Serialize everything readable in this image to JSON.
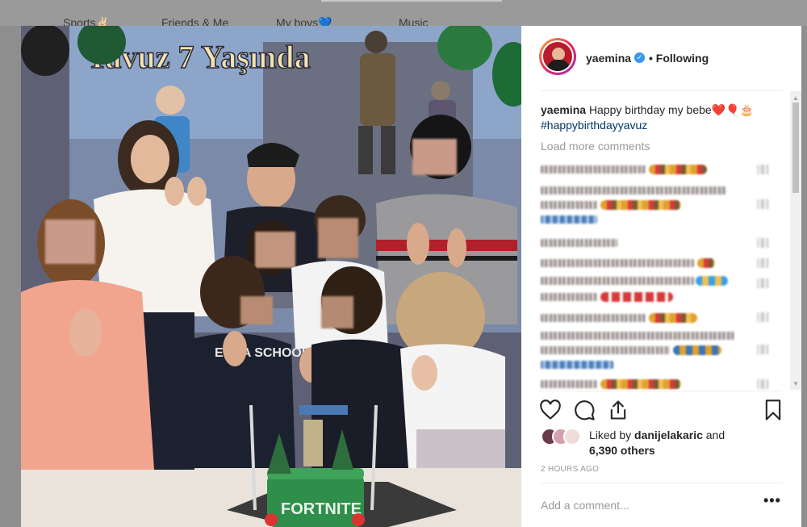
{
  "background_nav": {
    "tabs": [
      "Sports✌🏻",
      "Friends & Me",
      "My boys💙",
      "Music"
    ]
  },
  "photo": {
    "banner_text": "Yavuz 7 Yaşında",
    "cake_text": "FORTNITE",
    "shirt_text": "ENKA SCHOOLS"
  },
  "post": {
    "username": "yaemina",
    "verified_icon": "verified-badge-icon",
    "separator": "•",
    "follow_status": "Following",
    "caption_user": "yaemina",
    "caption_text": "Happy birthday my bebe❤️🎈🎂",
    "hashtag": "#happybirthdayyavuz",
    "load_more": "Load more comments",
    "liked_by_prefix": "Liked by",
    "liked_by_user": "danijelakaric",
    "liked_by_and": "and",
    "likes_count": "6,390 others",
    "timestamp": "2 HOURS AGO",
    "add_comment_placeholder": "Add a comment...",
    "more_options": "•••"
  },
  "icons": {
    "like": "heart-icon",
    "comment": "comment-icon",
    "share": "share-icon",
    "save": "bookmark-icon"
  },
  "colors": {
    "link": "#003569",
    "verified": "#3897f0",
    "muted": "#999999",
    "text": "#262626"
  }
}
